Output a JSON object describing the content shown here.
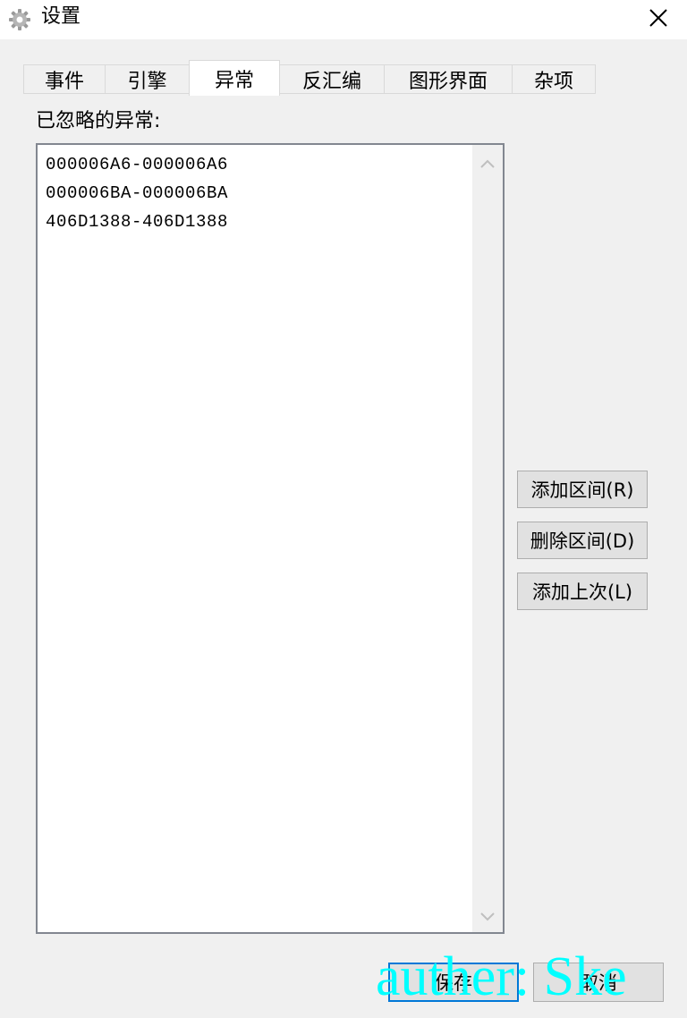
{
  "window": {
    "title": "设置",
    "icon": "gear-icon",
    "close_icon": "close-icon"
  },
  "tabs": [
    {
      "label": "事件",
      "active": false
    },
    {
      "label": "引擎",
      "active": false
    },
    {
      "label": "异常",
      "active": true
    },
    {
      "label": "反汇编",
      "active": false
    },
    {
      "label": "图形界面",
      "active": false
    },
    {
      "label": "杂项",
      "active": false
    }
  ],
  "exceptions": {
    "label": "已忽略的异常:",
    "items": [
      "000006A6-000006A6",
      "000006BA-000006BA",
      "406D1388-406D1388"
    ]
  },
  "buttons": {
    "add_range": "添加区间(R)",
    "delete_range": "删除区间(D)",
    "add_last": "添加上次(L)",
    "save": "保存",
    "cancel": "取消"
  },
  "watermark": "auther: Ske",
  "colors": {
    "window_bg": "#f0f0f0",
    "watermark": "#00ffff",
    "focus_border": "#0078d7"
  }
}
